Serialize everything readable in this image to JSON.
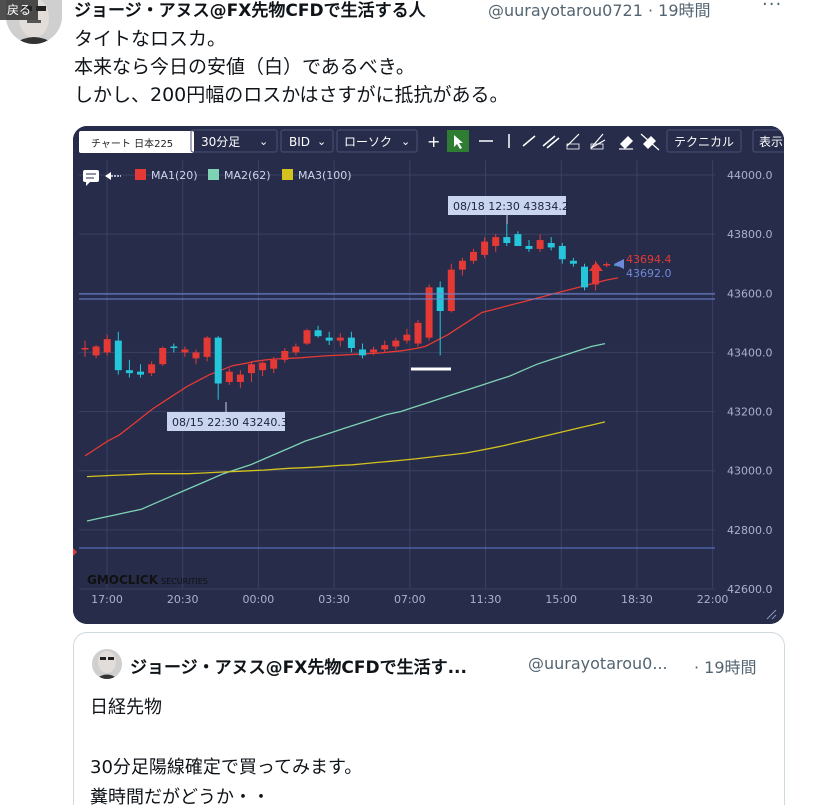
{
  "back_button": {
    "label": "戻る"
  },
  "tweet": {
    "author_name": "ジョージ・アヌス@FX先物CFDで生活する人",
    "handle": "@uurayotarou0721",
    "time": "· 19時間",
    "more": "···",
    "lines": [
      "タイトなロスカ。",
      "本来なら今日の安値（白）であるべき。",
      "しかし、200円幅のロスかはさすがに抵抗がある。"
    ]
  },
  "chart": {
    "toolbar": {
      "tooltip": "チャート 日本225",
      "timeframe": "30分足",
      "side": "BID",
      "chart_type": "ローソク",
      "technical": "テクニカル",
      "display": "表示"
    },
    "legend": [
      {
        "name": "MA1(20)",
        "color": "#e53935"
      },
      {
        "name": "MA2(62)",
        "color": "#7fd3b5"
      },
      {
        "name": "MA3(100)",
        "color": "#d4c21e"
      }
    ],
    "annotations": {
      "high_label": "08/18 12:30 43834.2",
      "low_label": "08/15 22:30 43240.3",
      "price_red": "43694.4",
      "price_blue": "43692.0"
    },
    "watermark_main": "GMOCLICK",
    "watermark_sub": "SECURITIES",
    "colors": {
      "background": "#262c4a",
      "up": "#e53935",
      "down": "#26c6da",
      "grid": "#3a4163"
    }
  },
  "chart_data": {
    "type": "candlestick",
    "y_ticks": [
      "44000.0",
      "43800.0",
      "43600.0",
      "43400.0",
      "43200.0",
      "43000.0",
      "42800.0",
      "42600.0"
    ],
    "x_ticks": [
      "17:00",
      "20:30",
      "00:00",
      "03:30",
      "07:00",
      "11:30",
      "15:00",
      "18:30",
      "22:00"
    ],
    "ylim": [
      42600,
      44000
    ],
    "candles": [
      {
        "o": 43410,
        "h": 43440,
        "l": 43385,
        "c": 43415
      },
      {
        "o": 43390,
        "h": 43425,
        "l": 43380,
        "c": 43420
      },
      {
        "o": 43400,
        "h": 43460,
        "l": 43390,
        "c": 43445
      },
      {
        "o": 43440,
        "h": 43470,
        "l": 43325,
        "c": 43340
      },
      {
        "o": 43340,
        "h": 43375,
        "l": 43315,
        "c": 43330
      },
      {
        "o": 43335,
        "h": 43360,
        "l": 43315,
        "c": 43325
      },
      {
        "o": 43330,
        "h": 43370,
        "l": 43320,
        "c": 43360
      },
      {
        "o": 43360,
        "h": 43420,
        "l": 43355,
        "c": 43415
      },
      {
        "o": 43420,
        "h": 43430,
        "l": 43400,
        "c": 43415
      },
      {
        "o": 43400,
        "h": 43420,
        "l": 43385,
        "c": 43410
      },
      {
        "o": 43380,
        "h": 43410,
        "l": 43360,
        "c": 43400
      },
      {
        "o": 43385,
        "h": 43455,
        "l": 43370,
        "c": 43450
      },
      {
        "o": 43450,
        "h": 43455,
        "l": 43240,
        "c": 43295
      },
      {
        "o": 43300,
        "h": 43345,
        "l": 43290,
        "c": 43335
      },
      {
        "o": 43300,
        "h": 43340,
        "l": 43280,
        "c": 43325
      },
      {
        "o": 43330,
        "h": 43370,
        "l": 43300,
        "c": 43360
      },
      {
        "o": 43340,
        "h": 43370,
        "l": 43320,
        "c": 43365
      },
      {
        "o": 43345,
        "h": 43385,
        "l": 43330,
        "c": 43375
      },
      {
        "o": 43375,
        "h": 43415,
        "l": 43365,
        "c": 43405
      },
      {
        "o": 43400,
        "h": 43430,
        "l": 43390,
        "c": 43420
      },
      {
        "o": 43430,
        "h": 43480,
        "l": 43425,
        "c": 43475
      },
      {
        "o": 43475,
        "h": 43490,
        "l": 43450,
        "c": 43455
      },
      {
        "o": 43450,
        "h": 43470,
        "l": 43425,
        "c": 43440
      },
      {
        "o": 43440,
        "h": 43465,
        "l": 43420,
        "c": 43450
      },
      {
        "o": 43450,
        "h": 43470,
        "l": 43400,
        "c": 43415
      },
      {
        "o": 43410,
        "h": 43430,
        "l": 43380,
        "c": 43390
      },
      {
        "o": 43400,
        "h": 43420,
        "l": 43390,
        "c": 43410
      },
      {
        "o": 43410,
        "h": 43440,
        "l": 43400,
        "c": 43425
      },
      {
        "o": 43420,
        "h": 43450,
        "l": 43410,
        "c": 43440
      },
      {
        "o": 43440,
        "h": 43480,
        "l": 43430,
        "c": 43460
      },
      {
        "o": 43430,
        "h": 43510,
        "l": 43420,
        "c": 43500
      },
      {
        "o": 43450,
        "h": 43630,
        "l": 43440,
        "c": 43620
      },
      {
        "o": 43620,
        "h": 43640,
        "l": 43390,
        "c": 43540
      },
      {
        "o": 43540,
        "h": 43700,
        "l": 43535,
        "c": 43680
      },
      {
        "o": 43680,
        "h": 43720,
        "l": 43660,
        "c": 43710
      },
      {
        "o": 43710,
        "h": 43750,
        "l": 43700,
        "c": 43740
      },
      {
        "o": 43730,
        "h": 43790,
        "l": 43720,
        "c": 43775
      },
      {
        "o": 43760,
        "h": 43800,
        "l": 43740,
        "c": 43790
      },
      {
        "o": 43790,
        "h": 43834,
        "l": 43760,
        "c": 43770
      },
      {
        "o": 43800,
        "h": 43810,
        "l": 43760,
        "c": 43760
      },
      {
        "o": 43760,
        "h": 43780,
        "l": 43740,
        "c": 43750
      },
      {
        "o": 43750,
        "h": 43800,
        "l": 43740,
        "c": 43780
      },
      {
        "o": 43770,
        "h": 43790,
        "l": 43745,
        "c": 43755
      },
      {
        "o": 43760,
        "h": 43770,
        "l": 43700,
        "c": 43715
      },
      {
        "o": 43710,
        "h": 43720,
        "l": 43690,
        "c": 43700
      },
      {
        "o": 43690,
        "h": 43700,
        "l": 43610,
        "c": 43620
      },
      {
        "o": 43630,
        "h": 43710,
        "l": 43610,
        "c": 43695
      },
      {
        "o": 43695,
        "h": 43705,
        "l": 43688,
        "c": 43699
      },
      {
        "o": 43698,
        "h": 43705,
        "l": 43690,
        "c": 43694
      }
    ],
    "ma1": [
      43050,
      43075,
      43100,
      43120,
      43150,
      43180,
      43210,
      43235,
      43260,
      43285,
      43305,
      43325,
      43340,
      43355,
      43362,
      43370,
      43375,
      43378,
      43380,
      43382,
      43385,
      43388,
      43390,
      43392,
      43394,
      43396,
      43398,
      43402,
      43406,
      43412,
      43420,
      43440,
      43460,
      43485,
      43510,
      43535,
      43545,
      43555,
      43565,
      43575,
      43585,
      43595,
      43605,
      43615,
      43625,
      43635,
      43645,
      43652
    ],
    "ma2": [
      42830,
      42840,
      42850,
      42860,
      42870,
      42890,
      42910,
      42930,
      42950,
      42970,
      42990,
      43005,
      43020,
      43040,
      43060,
      43080,
      43100,
      43115,
      43130,
      43145,
      43160,
      43175,
      43190,
      43200,
      43215,
      43230,
      43245,
      43260,
      43275,
      43290,
      43305,
      43320,
      43340,
      43360,
      43375,
      43390,
      43405,
      43420,
      43430
    ],
    "ma3": [
      42980,
      42982,
      42984,
      42986,
      42988,
      42990,
      42990,
      42990,
      42990,
      42992,
      42994,
      42996,
      42998,
      43000,
      43002,
      43005,
      43008,
      43010,
      43012,
      43015,
      43018,
      43020,
      43024,
      43028,
      43032,
      43036,
      43040,
      43045,
      43050,
      43055,
      43060,
      43068,
      43076,
      43085,
      43095,
      43105,
      43115,
      43125,
      43135,
      43145,
      43155,
      43165
    ]
  },
  "quote": {
    "author_name": "ジョージ・アヌス@FX先物CFDで生活す...",
    "handle": "@uurayotarou0...",
    "time": "· 19時間",
    "lines": [
      "日経先物",
      "",
      "30分足陽線確定で買ってみます。",
      "糞時間だがどうか・・"
    ]
  }
}
